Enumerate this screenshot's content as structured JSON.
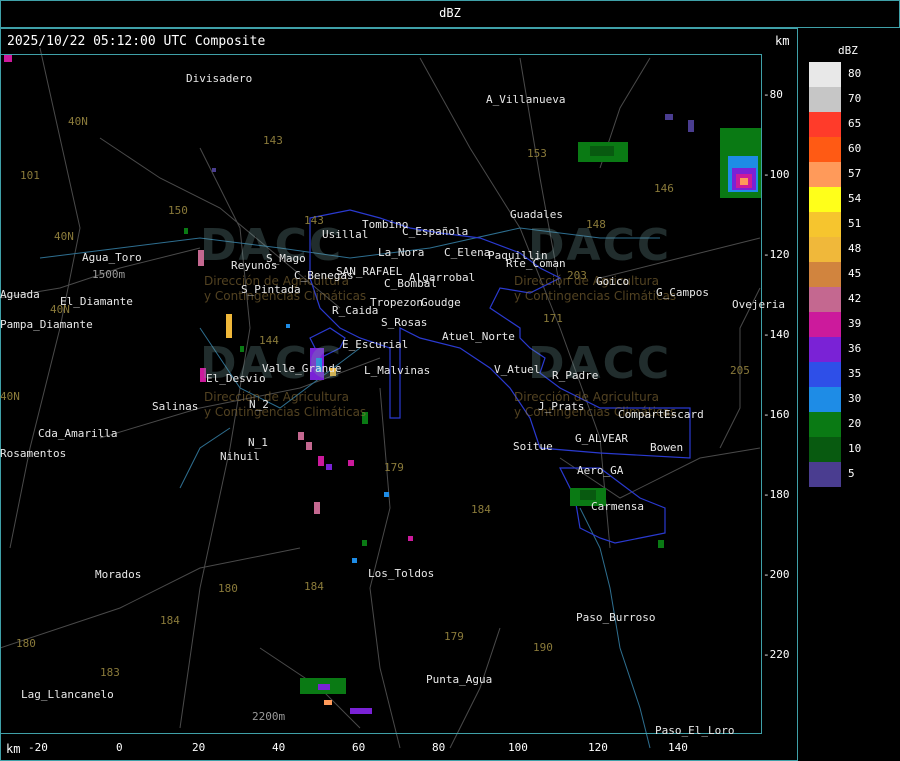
{
  "title": "dBZ",
  "timestamp": "2025/10/22 05:12:00 UTC Composite",
  "units": "km",
  "x_ticks": [
    "-20",
    "0",
    "20",
    "40",
    "60",
    "80",
    "100",
    "120",
    "140"
  ],
  "y_ticks": [
    "-80",
    "-100",
    "-120",
    "-140",
    "-160",
    "-180",
    "-200",
    "-220"
  ],
  "legend": {
    "title": "dBZ",
    "entries": [
      {
        "label": "80",
        "color": "#e8e8e8"
      },
      {
        "label": "70",
        "color": "#c6c6c6"
      },
      {
        "label": "65",
        "color": "#ff3b2a"
      },
      {
        "label": "60",
        "color": "#ff5a14"
      },
      {
        "label": "57",
        "color": "#ff9a5a"
      },
      {
        "label": "54",
        "color": "#ffff1a"
      },
      {
        "label": "51",
        "color": "#f6c52e"
      },
      {
        "label": "48",
        "color": "#f0b83a"
      },
      {
        "label": "45",
        "color": "#d1843e"
      },
      {
        "label": "42",
        "color": "#c46890"
      },
      {
        "label": "39",
        "color": "#cc1a9c"
      },
      {
        "label": "36",
        "color": "#7a22d6"
      },
      {
        "label": "35",
        "color": "#2e4fe8"
      },
      {
        "label": "30",
        "color": "#1e8ce6"
      },
      {
        "label": "20",
        "color": "#0a7a14"
      },
      {
        "label": "10",
        "color": "#085a10"
      },
      {
        "label": "5",
        "color": "#4a3d90"
      }
    ]
  },
  "places": [
    "Divisadero",
    "A_Villanueva",
    "Guadales",
    "Tombino",
    "Usillal",
    "C_Española",
    "La_Nora",
    "C_Elena",
    "Paquillin",
    "Rte_Coman",
    "Reyunos",
    "S_Mago",
    "C_Benegas",
    "SAN_RAFAEL",
    "C_Bombal",
    "Algarrobal",
    "Goico",
    "G_Campos",
    "Ovejeria",
    "Aguada",
    "Pampa_Diamante",
    "Agua_Toro",
    "El_Diamante",
    "S_Pintada",
    "R_Caida",
    "Tropezon",
    "Goudge",
    "S_Rosas",
    "Atuel_Norte",
    "E_Escurial",
    "Valle_Grande",
    "L_Malvinas",
    "V_Atuel",
    "R_Padre",
    "El_Desvio",
    "N_2",
    "Salinas",
    "J_Prats",
    "Compart",
    "Escard",
    "Cda_Amarilla",
    "Rosamentos",
    "N_1",
    "Nihuil",
    "G_ALVEAR",
    "Soitue",
    "Bowen",
    "Aero_GA",
    "Carmensa",
    "Morados",
    "Los_Toldos",
    "Paso_Burroso",
    "Punta_Agua",
    "Lag_Llancanelo",
    "Paso_El_Loro",
    "1500m",
    "2200m"
  ],
  "routes": [
    "40N",
    "101",
    "40N",
    "40N",
    "143",
    "150",
    "153",
    "146",
    "148",
    "203",
    "171",
    "144",
    "180",
    "179",
    "184",
    "180",
    "184",
    "183",
    "179",
    "190",
    "143",
    "40N",
    "184",
    "205",
    "180"
  ],
  "watermark": {
    "text": "DACC",
    "subtitle_1": "Dirección de Agricultura",
    "subtitle_2": "y Contingencias Climáticas"
  }
}
